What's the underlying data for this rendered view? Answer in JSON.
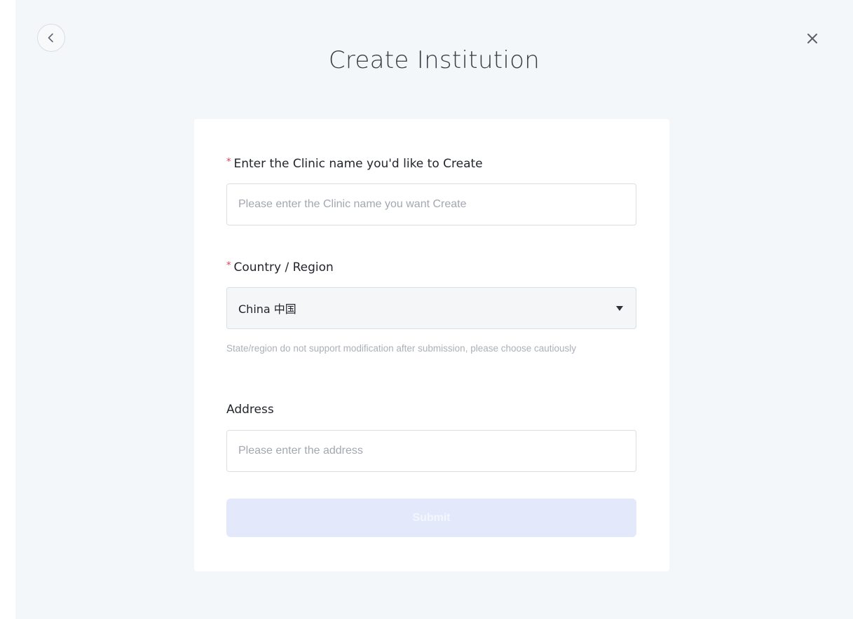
{
  "icons": {
    "back": "chevron-left-icon",
    "close": "close-icon",
    "dropdown": "caret-down-icon"
  },
  "title": "Create Institution",
  "form": {
    "clinic_name": {
      "required_mark": "*",
      "label": "Enter the Clinic name you'd like to Create",
      "value": "",
      "placeholder": "Please enter the Clinic name you want Create"
    },
    "country": {
      "required_mark": "*",
      "label": "Country / Region",
      "selected": "China 中国",
      "hint": "State/region do not support modification after submission, please choose cautiously"
    },
    "address": {
      "label": "Address",
      "value": "",
      "placeholder": "Please enter the address"
    },
    "submit_label": "Submit",
    "submit_disabled": true
  },
  "colors": {
    "page_background": "#f4f7fa",
    "card_background": "#ffffff",
    "required_mark": "#e0424a",
    "submit_disabled_background": "#e3e9fb",
    "hint_text": "#aab0b9"
  }
}
